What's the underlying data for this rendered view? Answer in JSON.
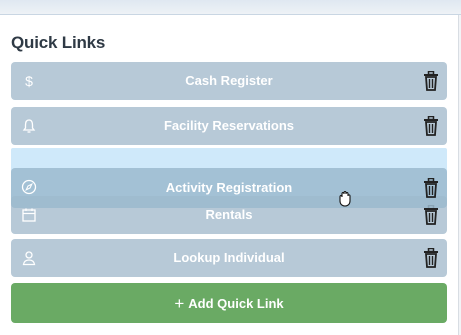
{
  "panel": {
    "title": "Quick Links"
  },
  "links": [
    {
      "label": "Cash Register",
      "icon": "dollar-icon"
    },
    {
      "label": "Facility Reservations",
      "icon": "bell-icon"
    },
    {
      "label": "Rentals",
      "icon": "calendar-icon"
    },
    {
      "label": "Lookup Individual",
      "icon": "person-icon"
    }
  ],
  "dragging": {
    "label": "Activity Registration",
    "icon": "compass-icon"
  },
  "add_button": {
    "label": "Add Quick Link",
    "icon": "plus-icon"
  },
  "colors": {
    "link_bg": "#b7c9d7",
    "drop_zone": "#cfe9fa",
    "add_button_bg": "#6aaa64",
    "title_text": "#2f3a45"
  }
}
